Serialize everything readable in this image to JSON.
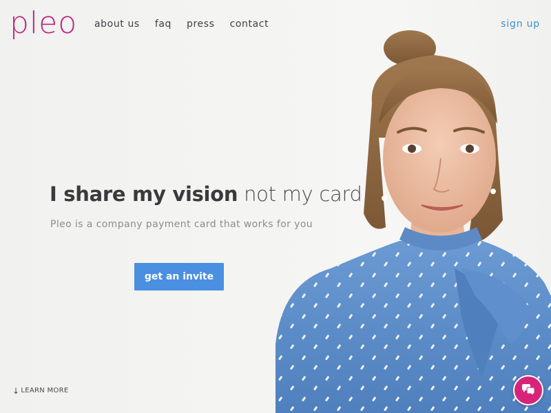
{
  "brand": {
    "logo": "pleo",
    "color": "#c2237f"
  },
  "nav": {
    "items": [
      {
        "label": "about us"
      },
      {
        "label": "faq"
      },
      {
        "label": "press"
      },
      {
        "label": "contact"
      }
    ],
    "signup_label": "sign up"
  },
  "hero": {
    "headline_bold": "I share my vision",
    "headline_light": " not my card",
    "subline": "Pleo is a company payment card that works for you",
    "cta_label": "get an invite",
    "learn_more": "LEARN MORE",
    "learn_more_arrow": "↓"
  },
  "chat": {
    "icon": "chat-bubbles-icon",
    "color": "#d8237a"
  },
  "colors": {
    "accent": "#4a8fe0",
    "link": "#3b8fd8",
    "blouse": "#5b8cc8"
  }
}
